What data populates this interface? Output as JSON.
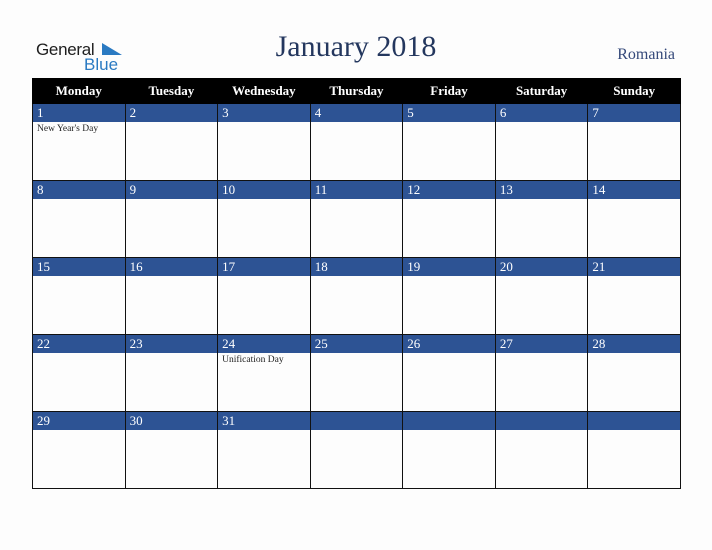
{
  "logo": {
    "general": "General",
    "blue": "Blue"
  },
  "title": "January 2018",
  "country": "Romania",
  "weekdays": [
    "Monday",
    "Tuesday",
    "Wednesday",
    "Thursday",
    "Friday",
    "Saturday",
    "Sunday"
  ],
  "weeks": [
    [
      {
        "day": "1",
        "event": "New Year's Day"
      },
      {
        "day": "2",
        "event": ""
      },
      {
        "day": "3",
        "event": ""
      },
      {
        "day": "4",
        "event": ""
      },
      {
        "day": "5",
        "event": ""
      },
      {
        "day": "6",
        "event": ""
      },
      {
        "day": "7",
        "event": ""
      }
    ],
    [
      {
        "day": "8",
        "event": ""
      },
      {
        "day": "9",
        "event": ""
      },
      {
        "day": "10",
        "event": ""
      },
      {
        "day": "11",
        "event": ""
      },
      {
        "day": "12",
        "event": ""
      },
      {
        "day": "13",
        "event": ""
      },
      {
        "day": "14",
        "event": ""
      }
    ],
    [
      {
        "day": "15",
        "event": ""
      },
      {
        "day": "16",
        "event": ""
      },
      {
        "day": "17",
        "event": ""
      },
      {
        "day": "18",
        "event": ""
      },
      {
        "day": "19",
        "event": ""
      },
      {
        "day": "20",
        "event": ""
      },
      {
        "day": "21",
        "event": ""
      }
    ],
    [
      {
        "day": "22",
        "event": ""
      },
      {
        "day": "23",
        "event": ""
      },
      {
        "day": "24",
        "event": "Unification Day"
      },
      {
        "day": "25",
        "event": ""
      },
      {
        "day": "26",
        "event": ""
      },
      {
        "day": "27",
        "event": ""
      },
      {
        "day": "28",
        "event": ""
      }
    ],
    [
      {
        "day": "29",
        "event": ""
      },
      {
        "day": "30",
        "event": ""
      },
      {
        "day": "31",
        "event": ""
      },
      {
        "day": "",
        "event": ""
      },
      {
        "day": "",
        "event": ""
      },
      {
        "day": "",
        "event": ""
      },
      {
        "day": "",
        "event": ""
      }
    ]
  ],
  "colors": {
    "band": "#2d5394",
    "header": "#000000",
    "title": "#24375e",
    "logo_blue": "#2a7ac2"
  }
}
